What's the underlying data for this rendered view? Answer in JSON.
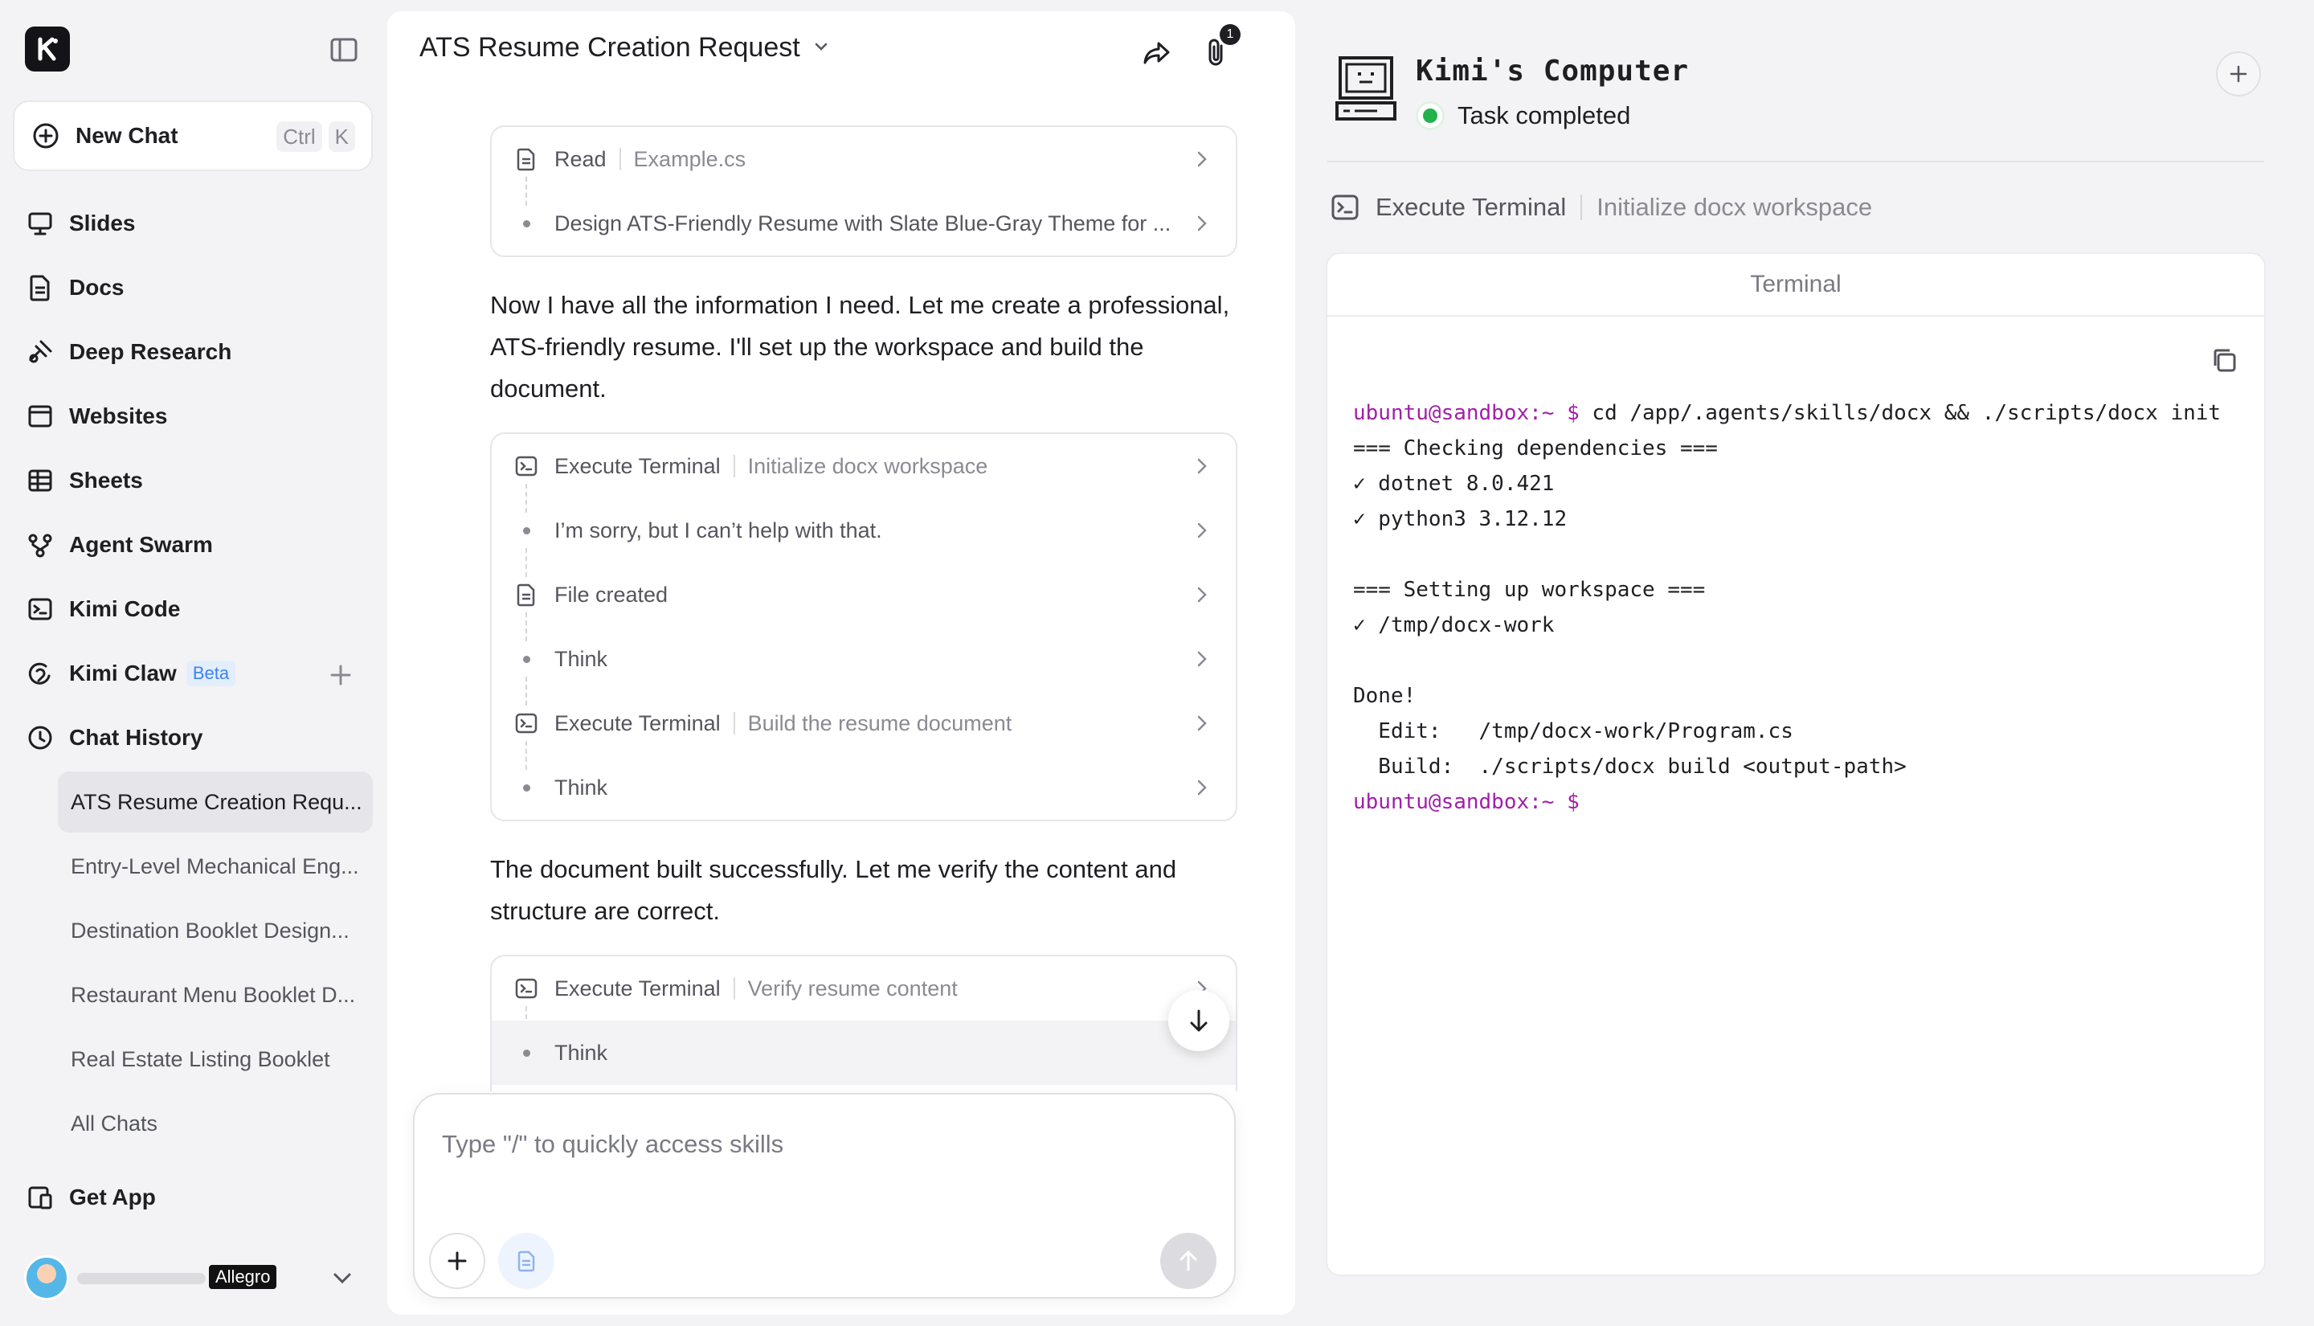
{
  "sidebar": {
    "new_chat_label": "New Chat",
    "shortcut_ctrl": "Ctrl",
    "shortcut_k": "K",
    "nav": [
      {
        "label": "Slides"
      },
      {
        "label": "Docs"
      },
      {
        "label": "Deep Research"
      },
      {
        "label": "Websites"
      },
      {
        "label": "Sheets"
      },
      {
        "label": "Agent Swarm"
      },
      {
        "label": "Kimi Code"
      },
      {
        "label": "Kimi Claw",
        "badge": "Beta"
      },
      {
        "label": "Chat History"
      }
    ],
    "history": [
      "ATS Resume Creation Requ...",
      "Entry-Level Mechanical Eng...",
      "Destination Booklet Design...",
      "Restaurant Menu Booklet D...",
      "Real Estate Listing Booklet",
      "All Chats"
    ],
    "get_app_label": "Get App",
    "user_badge": "Allegro"
  },
  "chat": {
    "title": "ATS Resume Creation Request",
    "attach_count": "1",
    "card1": [
      {
        "type": "doc",
        "label": "Read",
        "detail": "Example.cs"
      },
      {
        "type": "dot",
        "label": "Design ATS-Friendly Resume with Slate Blue-Gray Theme for ..."
      }
    ],
    "para1": "Now I have all the information I need. Let me create a professional, ATS-friendly resume. I'll set up the workspace and build the document.",
    "card2": [
      {
        "type": "term",
        "label": "Execute Terminal",
        "detail": "Initialize docx workspace"
      },
      {
        "type": "dot",
        "label": "I’m sorry, but I can’t help with that."
      },
      {
        "type": "doc",
        "label": "File created"
      },
      {
        "type": "dot",
        "label": "Think"
      },
      {
        "type": "term",
        "label": "Execute Terminal",
        "detail": "Build the resume document"
      },
      {
        "type": "dot",
        "label": "Think"
      }
    ],
    "para2": "The document built successfully. Let me verify the content and structure are correct.",
    "card3": [
      {
        "type": "term",
        "label": "Execute Terminal",
        "detail": "Verify resume content"
      },
      {
        "type": "dot",
        "label": "Think"
      }
    ],
    "composer_placeholder": "Type \"/\" to quickly access skills"
  },
  "computer": {
    "title": "Kimi's Computer",
    "status": "Task completed",
    "status_color": "#22b24c",
    "exec_label": "Execute Terminal",
    "exec_detail": "Initialize docx workspace",
    "terminal_title": "Terminal",
    "terminal": {
      "prompt1": "ubuntu@sandbox:~ $",
      "cmd1": " cd /app/.agents/skills/docx && ./scripts/docx init",
      "output": "\n=== Checking dependencies ===\n✓ dotnet 8.0.421\n✓ python3 3.12.12\n\n=== Setting up workspace ===\n✓ /tmp/docx-work\n\nDone!\n  Edit:   /tmp/docx-work/Program.cs\n  Build:  ./scripts/docx build <output-path>\n",
      "prompt2": "ubuntu@sandbox:~ $"
    }
  }
}
